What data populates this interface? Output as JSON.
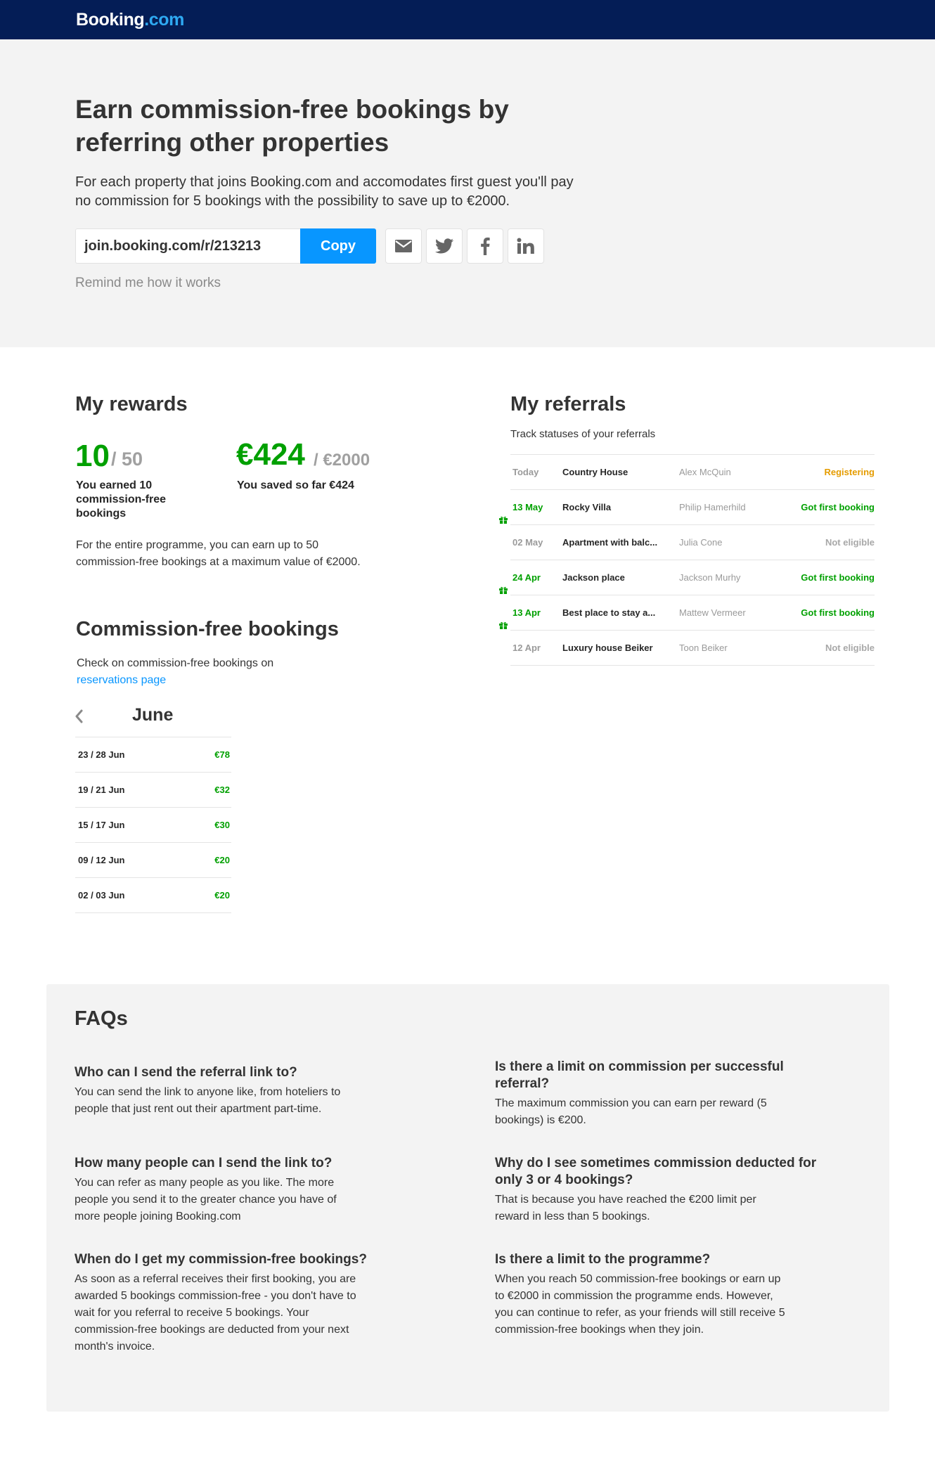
{
  "brand": {
    "logo_main": "Booking",
    "logo_suffix": ".com"
  },
  "hero": {
    "title": "Earn commission-free bookings by referring other properties",
    "description": "For each property that joins Booking.com and accomodates first guest you'll pay no commission for 5 bookings with the possibility to save up to €2000.",
    "referral_link": "join.booking.com/r/213213",
    "copy_label": "Copy",
    "share_icons": [
      "mail-icon",
      "twitter-icon",
      "facebook-icon",
      "linkedin-icon"
    ],
    "remind_label": "Remind me how it works"
  },
  "rewards": {
    "title": "My rewards",
    "earned": "10",
    "earned_max": "/ 50",
    "earned_caption": "You earned 10 commission-free bookings",
    "saved": "€424",
    "saved_max": "/ €2000",
    "saved_caption": "You saved so far €424",
    "note": "For the entire programme, you can earn up to 50 commission-free bookings at a maximum value of €2000."
  },
  "commission_free": {
    "title": "Commission-free bookings",
    "intro": "Check on commission-free bookings on",
    "link_label": "reservations page",
    "month": "June",
    "rows": [
      {
        "dates": "23 / 28 Jun",
        "amount": "€78"
      },
      {
        "dates": "19 / 21 Jun",
        "amount": "€32"
      },
      {
        "dates": "15 / 17 Jun",
        "amount": "€30"
      },
      {
        "dates": "09 / 12 Jun",
        "amount": "€20"
      },
      {
        "dates": "02 / 03 Jun",
        "amount": "€20"
      }
    ]
  },
  "referrals": {
    "title": "My referrals",
    "subtitle": "Track statuses of your referrals",
    "rows": [
      {
        "date": "Today",
        "property": "Country House",
        "person": "Alex McQuin",
        "status": "Registering",
        "gift": false
      },
      {
        "date": "13 May",
        "property": "Rocky Villa",
        "person": "Philip Hamerhild",
        "status": "Got first booking",
        "gift": true
      },
      {
        "date": "02 May",
        "property": "Apartment with balc...",
        "person": "Julia Cone",
        "status": "Not eligible",
        "gift": false
      },
      {
        "date": "24 Apr",
        "property": "Jackson place",
        "person": "Jackson Murhy",
        "status": "Got first booking",
        "gift": true
      },
      {
        "date": "13 Apr",
        "property": "Best place to stay a...",
        "person": "Mattew Vermeer",
        "status": "Got first booking",
        "gift": true
      },
      {
        "date": "12 Apr",
        "property": "Luxury house Beiker",
        "person": "Toon Beiker",
        "status": "Not eligible",
        "gift": false
      }
    ],
    "status_colors": {
      "Registering": "#e59c00",
      "Got first booking": "#00a000",
      "Not eligible": "#a8a8a8"
    }
  },
  "faq": {
    "title": "FAQs",
    "items": [
      {
        "q": "Who can I send the referral link to?",
        "a": "You can send the link to anyone like, from hoteliers to people that just rent out their apartment part-time."
      },
      {
        "q": "Is there a limit on commission per successful referral?",
        "a": "The maximum commission you can earn per reward (5 bookings) is €200."
      },
      {
        "q": "How many people can I send the link to?",
        "a": "You can refer as many people as you like. The more people you send it to the greater chance you have of more people joining Booking.com"
      },
      {
        "q": "Why do I see sometimes commission deducted for only 3 or 4 bookings?",
        "a": "That is because you have reached the €200 limit per reward in less than 5 bookings."
      },
      {
        "q": "When do I get my commission-free bookings?",
        "a": "As soon as a referral receives their first booking, you are awarded 5 bookings commission-free - you don't have to wait for you referral to receive 5 bookings. Your commission-free bookings are deducted from your next month's invoice."
      },
      {
        "q": "Is there a limit to the programme?",
        "a": "When you reach 50 commission-free bookings or earn up to €2000 in commission the programme ends. However, you can continue to refer, as your friends will still receive 5 commission-free bookings when they join."
      }
    ]
  },
  "colors": {
    "header_bg": "#041d56",
    "accent": "#0896ff",
    "green": "#00a000",
    "hero_bg": "#f3f3f3"
  }
}
